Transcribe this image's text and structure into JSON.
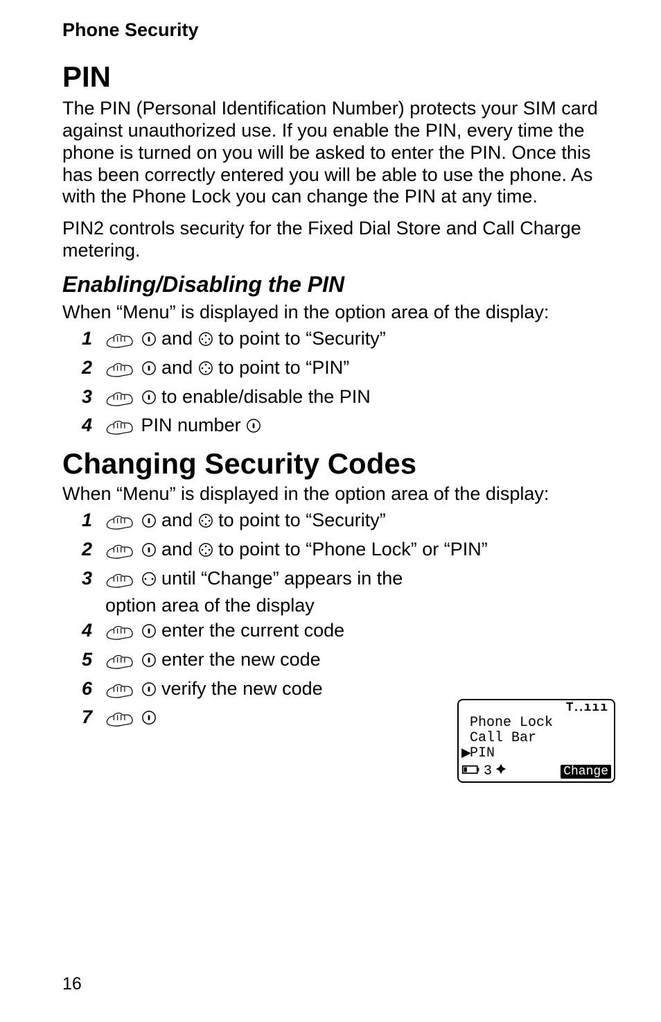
{
  "chapter_title": "Phone Security",
  "section_pin": {
    "heading": "PIN",
    "para1": "The PIN (Personal Identification Number) protects your SIM card against unauthorized use. If you enable the PIN, every time the phone is turned on you will be asked to enter the PIN. Once this has been correctly entered you will be able to use the phone. As with the Phone Lock you can change the PIN at any time.",
    "para2": "PIN2 controls security for the Fixed Dial Store and Call Charge metering."
  },
  "enable_pin": {
    "heading": "Enabling/Disabling the PIN",
    "lead": "When “Menu” is displayed in the option area of the display:",
    "steps": [
      {
        "n": "1",
        "pre": "",
        "mid": " and ",
        "post": " to point to “Security”",
        "icons": [
          "hand",
          "sel",
          "nav"
        ]
      },
      {
        "n": "2",
        "pre": "",
        "mid": " and ",
        "post": " to point to “PIN”",
        "icons": [
          "hand",
          "sel",
          "nav"
        ]
      },
      {
        "n": "3",
        "pre": "",
        "mid": "",
        "post": " to enable/disable the PIN",
        "icons": [
          "hand",
          "sel"
        ]
      },
      {
        "n": "4",
        "pre": "",
        "mid": " PIN number ",
        "post": "",
        "icons": [
          "hand",
          "",
          "sel"
        ]
      }
    ]
  },
  "changing_codes": {
    "heading": "Changing Security Codes",
    "lead": "When “Menu” is displayed in the option area of the display:",
    "steps": [
      {
        "n": "1",
        "text_a": " and ",
        "text_b": " to point to “Security”"
      },
      {
        "n": "2",
        "text_a": " and ",
        "text_b": " to point to “Phone Lock” or “PIN”"
      },
      {
        "n": "3",
        "text_a": " until “Change” appears in the",
        "text_b": "option area of the display"
      },
      {
        "n": "4",
        "text_a": " enter the current code"
      },
      {
        "n": "5",
        "text_a": " enter the new code"
      },
      {
        "n": "6",
        "text_a": " verify the new code"
      },
      {
        "n": "7",
        "text_a": ""
      }
    ]
  },
  "lcd": {
    "signal": "Τ․․ııı",
    "line1": "Phone Lock",
    "line2": "Call Bar",
    "line3": "PIN",
    "count": "3",
    "softkey": "Change"
  },
  "page_number": "16"
}
